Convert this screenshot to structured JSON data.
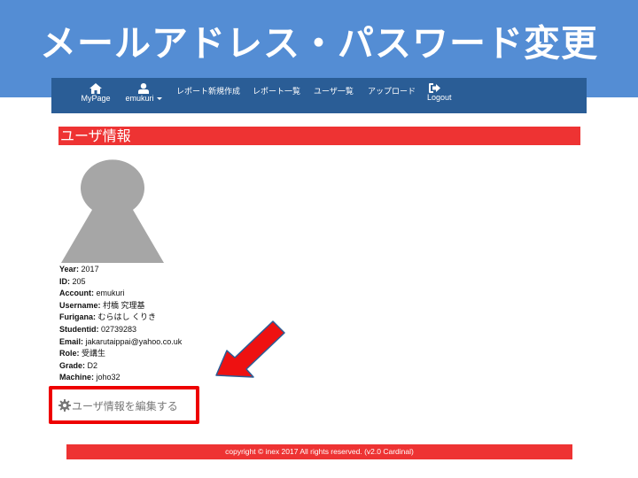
{
  "slide": {
    "title": "メールアドレス・パスワード変更"
  },
  "navbar": {
    "mypage": {
      "label": "MyPage",
      "icon": "home-icon"
    },
    "user": {
      "label": "emukuri",
      "icon": "user-icon"
    },
    "report_new": "レポート新規作成",
    "report_list": "レポート一覧",
    "user_list": "ユーザ一覧",
    "upload": "アップロード",
    "logout": {
      "label": "Logout",
      "icon": "sign-out-icon"
    }
  },
  "section": {
    "title": "ユーザ情報"
  },
  "user_info": [
    {
      "label": "Year:",
      "value": "2017"
    },
    {
      "label": "ID:",
      "value": "205"
    },
    {
      "label": "Account:",
      "value": "emukuri"
    },
    {
      "label": "Username:",
      "value": "村橋 究理基"
    },
    {
      "label": "Furigana:",
      "value": "むらはし くりき"
    },
    {
      "label": "Studentid:",
      "value": "02739283"
    },
    {
      "label": "Email:",
      "value": "jakarutaippai@yahoo.co.uk"
    },
    {
      "label": "Role:",
      "value": "受講生"
    },
    {
      "label": "Grade:",
      "value": "D2"
    },
    {
      "label": "Machine:",
      "value": "joho32"
    }
  ],
  "edit": {
    "label": "ユーザ情報を編集する",
    "icon": "gear-icon"
  },
  "footer": {
    "text": "copyright © inex 2017 All rights reserved. (v2.0 Cardinal)"
  },
  "colors": {
    "banner": "#548dd4",
    "navbar": "#2a5d96",
    "accent_red": "#ee3333",
    "highlight_red": "#ee0000"
  }
}
